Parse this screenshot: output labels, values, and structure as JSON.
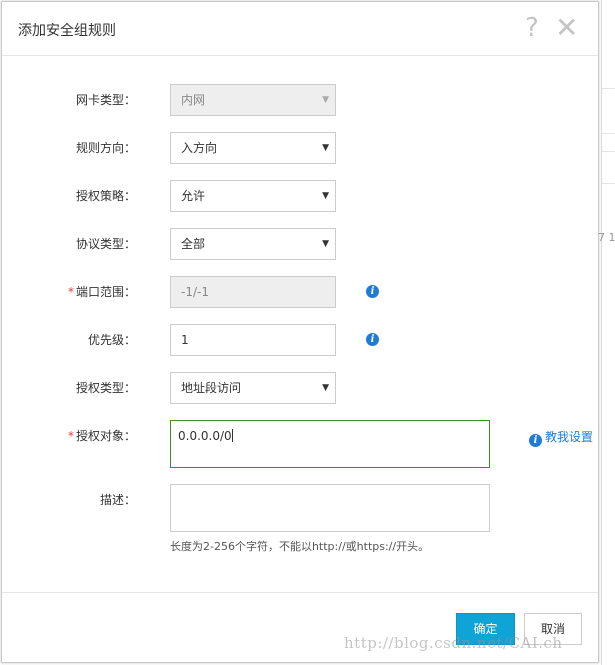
{
  "dialog": {
    "title": "添加安全组规则",
    "help_glyph": "?",
    "close_glyph": "✕"
  },
  "background_fragment": "7 1",
  "form": {
    "nic_type": {
      "label": "网卡类型：",
      "value": "内网",
      "disabled": true
    },
    "direction": {
      "label": "规则方向：",
      "value": "入方向"
    },
    "policy": {
      "label": "授权策略：",
      "value": "允许"
    },
    "protocol": {
      "label": "协议类型：",
      "value": "全部"
    },
    "port_range": {
      "label": "端口范围：",
      "required_mark": "*",
      "value": "-1/-1",
      "disabled": true
    },
    "priority": {
      "label": "优先级：",
      "value": "1"
    },
    "auth_type": {
      "label": "授权类型：",
      "value": "地址段访问"
    },
    "auth_object": {
      "label": "授权对象：",
      "required_mark": "*",
      "value": "0.0.0.0/0"
    },
    "teach_link": "教我设置",
    "description": {
      "label": "描述：",
      "value": "",
      "hint": "长度为2-256个字符，不能以http://或https://开头。"
    }
  },
  "buttons": {
    "ok": "确定",
    "cancel": "取消"
  },
  "watermark": "http://blog.csdn.net/CAI.ch",
  "colors": {
    "primary": "#0fa4d6",
    "info": "#1e7bd6",
    "required": "#e4393c",
    "focus_border": "#3b8f2a"
  },
  "icons": {
    "caret": "▼",
    "info": "i"
  }
}
